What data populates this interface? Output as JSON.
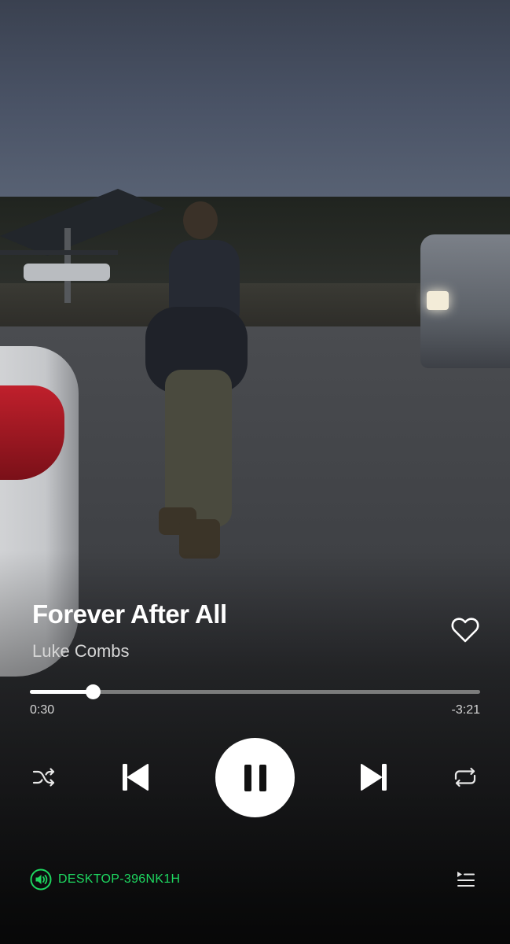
{
  "track": {
    "title": "Forever After All",
    "artist": "Luke Combs",
    "liked": false
  },
  "playback": {
    "elapsed": "0:30",
    "remaining": "-3:21",
    "progress": 0.14,
    "state": "playing"
  },
  "controls": {
    "icons": [
      "shuffle-icon",
      "previous-icon",
      "pause-icon",
      "next-icon",
      "repeat-icon"
    ]
  },
  "device": {
    "name": "DESKTOP-396NK1H",
    "icon": "speaker-icon"
  },
  "queue": {
    "icon": "queue-icon"
  },
  "colors": {
    "accent": "#1ed760",
    "text": "#ffffff",
    "secondary_text": "#d6d6d6",
    "track_background": "#7c7c7c"
  }
}
